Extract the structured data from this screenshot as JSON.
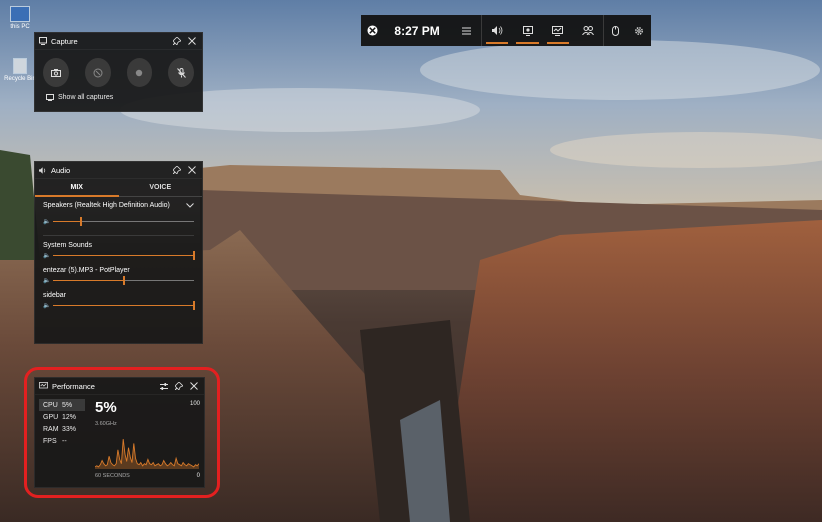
{
  "desktop_icons": [
    "this PC",
    "Recycle Bin"
  ],
  "topbar": {
    "time": "8:27 PM",
    "icons": [
      "xbox-icon",
      "menu-icon",
      "audio-icon",
      "capture-icon",
      "performance-icon",
      "social-icon",
      "mouse-icon",
      "settings-icon"
    ]
  },
  "capture": {
    "title": "Capture",
    "show_all": "Show all captures",
    "buttons": [
      "screenshot",
      "record-last",
      "record",
      "mic"
    ]
  },
  "audio": {
    "title": "Audio",
    "tab_mix": "MIX",
    "tab_voice": "VOICE",
    "device": "Speakers (Realtek High Definition Audio)",
    "device_level": 0.2,
    "apps": [
      {
        "name": "System Sounds",
        "level": 1.0
      },
      {
        "name": "entezar (5).MP3 - PotPlayer",
        "level": 0.5
      },
      {
        "name": "sidebar",
        "level": 1.0
      }
    ]
  },
  "performance": {
    "title": "Performance",
    "stats": [
      {
        "label": "CPU",
        "value": "5%"
      },
      {
        "label": "GPU",
        "value": "12%"
      },
      {
        "label": "RAM",
        "value": "33%"
      },
      {
        "label": "FPS",
        "value": "--"
      }
    ],
    "big_value": "5%",
    "freq": "3.60GHz",
    "max_label": "100",
    "min_label": "0",
    "duration": "60 SECONDS",
    "accent": "#d87a2a",
    "graph_values": [
      2,
      3,
      2,
      4,
      8,
      5,
      3,
      4,
      12,
      6,
      4,
      3,
      5,
      18,
      9,
      5,
      28,
      14,
      7,
      20,
      11,
      6,
      24,
      10,
      5,
      4,
      6,
      3,
      5,
      4,
      9,
      5,
      4,
      6,
      3,
      4,
      5,
      3,
      4,
      8,
      5,
      3,
      4,
      6,
      4,
      3,
      10,
      5,
      4,
      3,
      6,
      4,
      3,
      5,
      4,
      3,
      2,
      4,
      3,
      5
    ]
  }
}
